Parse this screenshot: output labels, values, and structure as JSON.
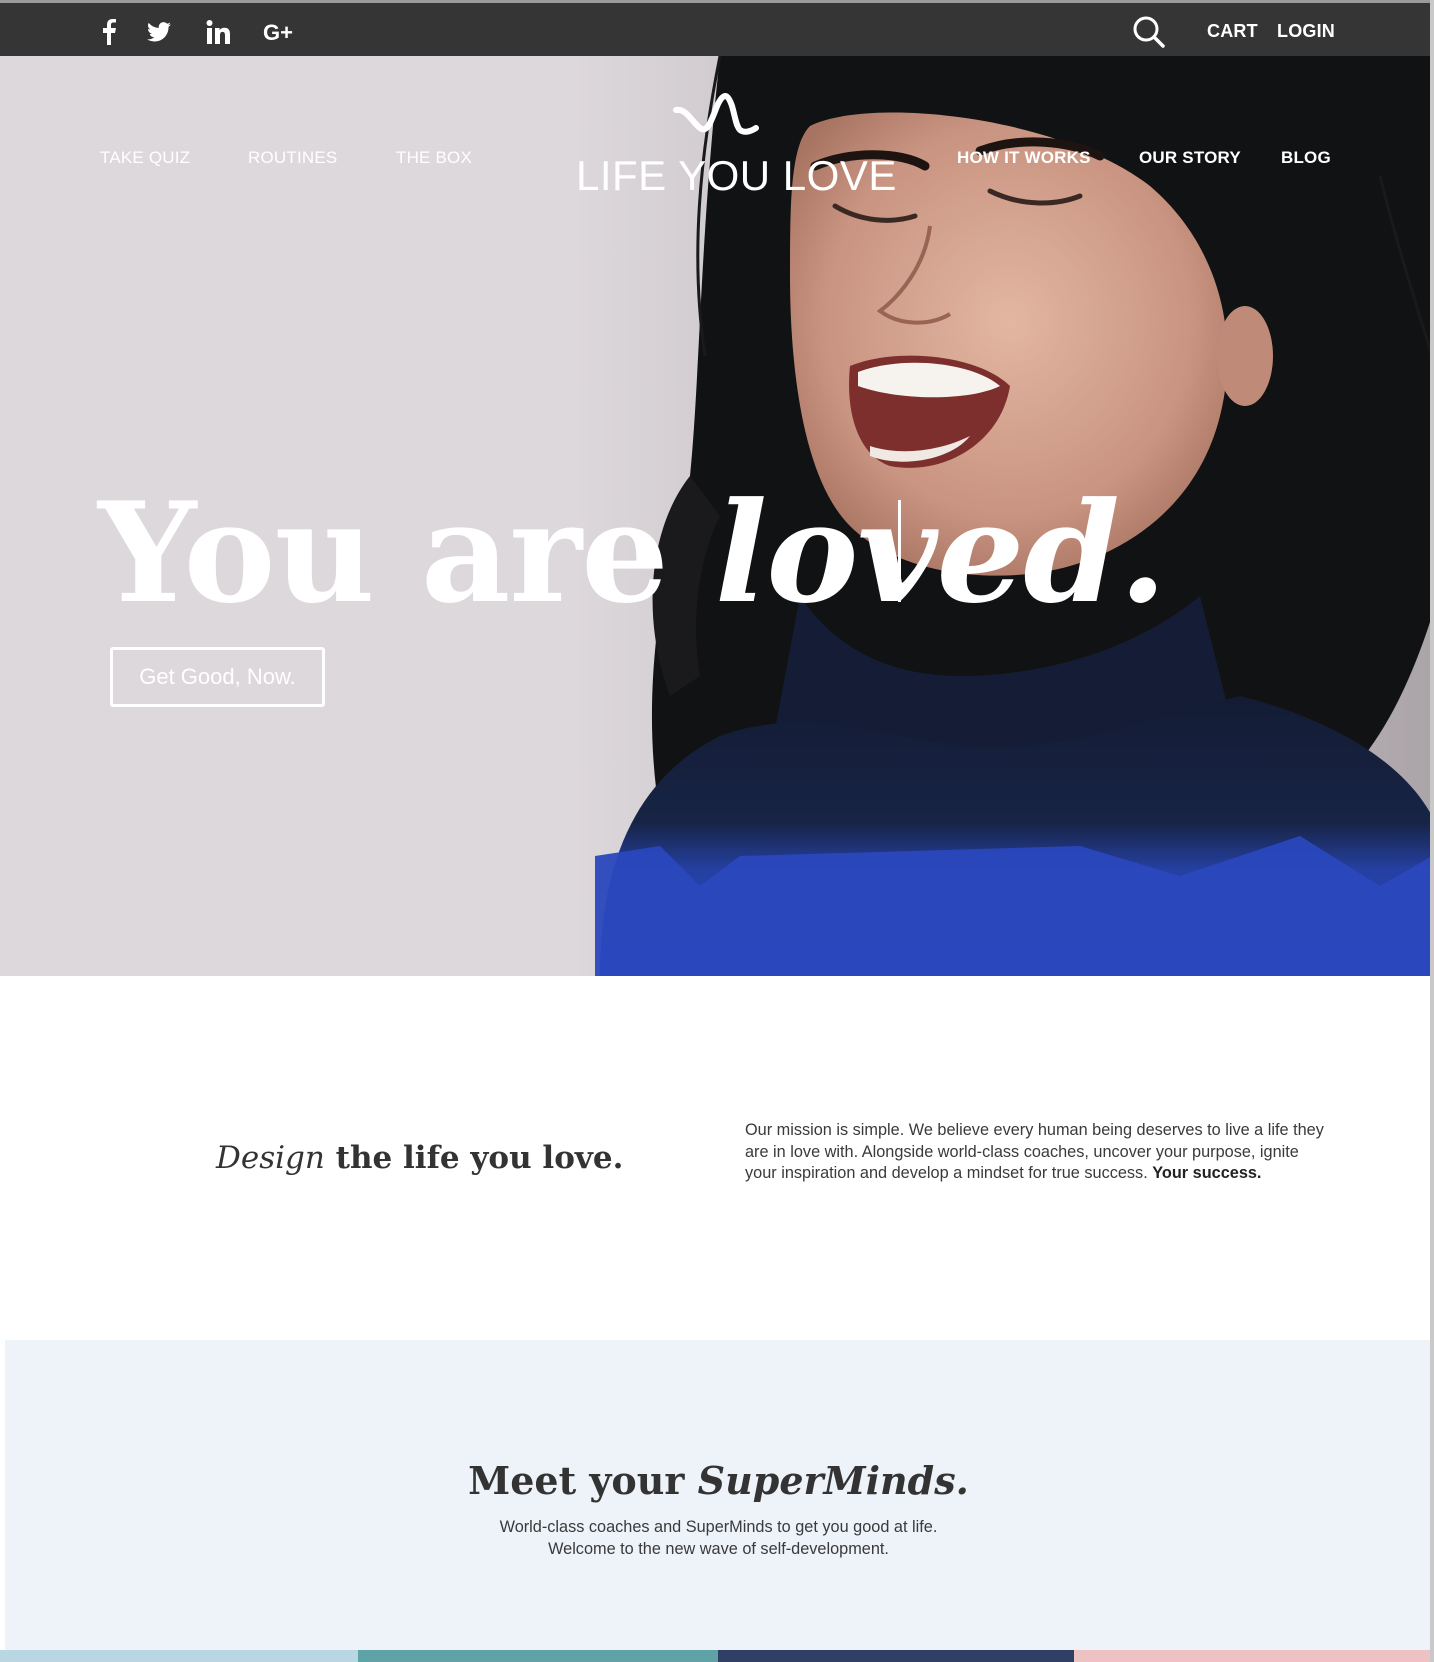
{
  "topbar": {
    "social": [
      {
        "name": "facebook-icon",
        "glyph": "f"
      },
      {
        "name": "twitter-icon",
        "glyph": "twitter"
      },
      {
        "name": "linkedin-icon",
        "glyph": "in"
      },
      {
        "name": "google-plus-icon",
        "glyph": "G+"
      }
    ],
    "cart_label": "CART",
    "login_label": "LOGIN"
  },
  "nav": {
    "left": [
      "TAKE QUIZ",
      "ROUTINES",
      "THE BOX"
    ],
    "right": [
      "HOW IT WORKS",
      "OUR STORY",
      "BLOG"
    ]
  },
  "logo": {
    "text": "LIFE YOU LOVE"
  },
  "hero": {
    "heading_plain": "You are ",
    "heading_emphasis": "loved.",
    "cta_label": "Get Good, Now."
  },
  "mission": {
    "heading_italic": "Design",
    "heading_bold": " the life you love.",
    "text": "Our mission is simple. We believe every human being deserves to live a life they are in love with. Alongside world-class coaches, uncover your purpose, ignite your inspiration and develop a mindset for true success. ",
    "text_strong": "Your success."
  },
  "superminds": {
    "heading_plain": "Meet your ",
    "heading_italic": "SuperMinds.",
    "line1": "World-class coaches and SuperMinds to get you good at life.",
    "line2": "Welcome to the new wave of self-development."
  },
  "colors": {
    "topbar": "#353535",
    "hero_bg": "#ddd8dc",
    "sweater_blue": "#2846b8",
    "section_bg": "#eef2f9",
    "strip": [
      "#b9d6e3",
      "#5fa3a6",
      "#2f3f66",
      "#ecc2c2"
    ]
  }
}
